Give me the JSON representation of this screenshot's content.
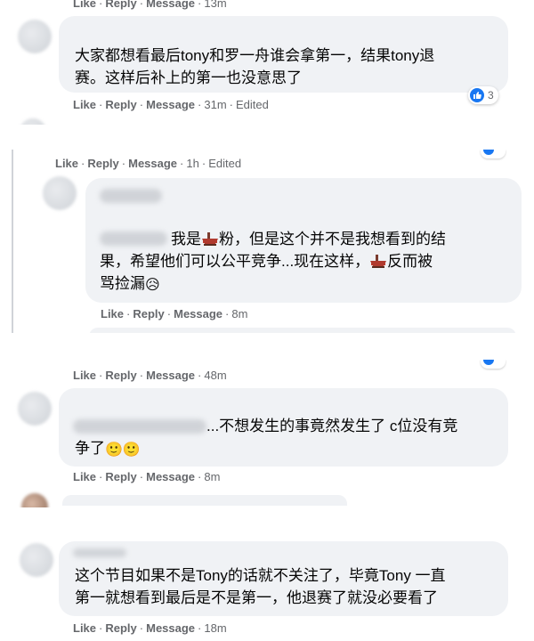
{
  "meta_labels": {
    "like": "Like",
    "reply": "Reply",
    "message": "Message",
    "sep": "·"
  },
  "comments": [
    {
      "time": "13m"
    },
    {
      "lines": [
        "大家都想看最后tony和罗一舟谁会拿第一，结果tony退",
        "赛。这样后补上的第一也没意思了"
      ],
      "reactions": "3",
      "time": "31m",
      "edited": "Edited"
    },
    {
      "time": "1h",
      "edited": "Edited"
    },
    {
      "lines": [
        "我是",
        "粉，但是这个并不是我想看到的结",
        "果，希望他们可以公平竞争...现在这样，",
        "反而被",
        "骂捡漏",
        "😥"
      ],
      "time": "8m"
    },
    {
      "time": "48m"
    },
    {
      "lines": [
        "...不想发生的事竟然发生了 c位没有竞",
        "争了",
        "🙂🙂"
      ],
      "time": "8m"
    },
    {
      "lines": [
        "这个节目如果不是Tony的话就不关注了，毕竟Tony 一直",
        "第一就想看到最后是不是第一，他退赛了就没必要看了"
      ],
      "time": "18m"
    }
  ],
  "colors": {
    "bubble": "#f0f2f5",
    "meta": "#65676b",
    "like_blue": "#1877f2",
    "text": "#050505"
  }
}
